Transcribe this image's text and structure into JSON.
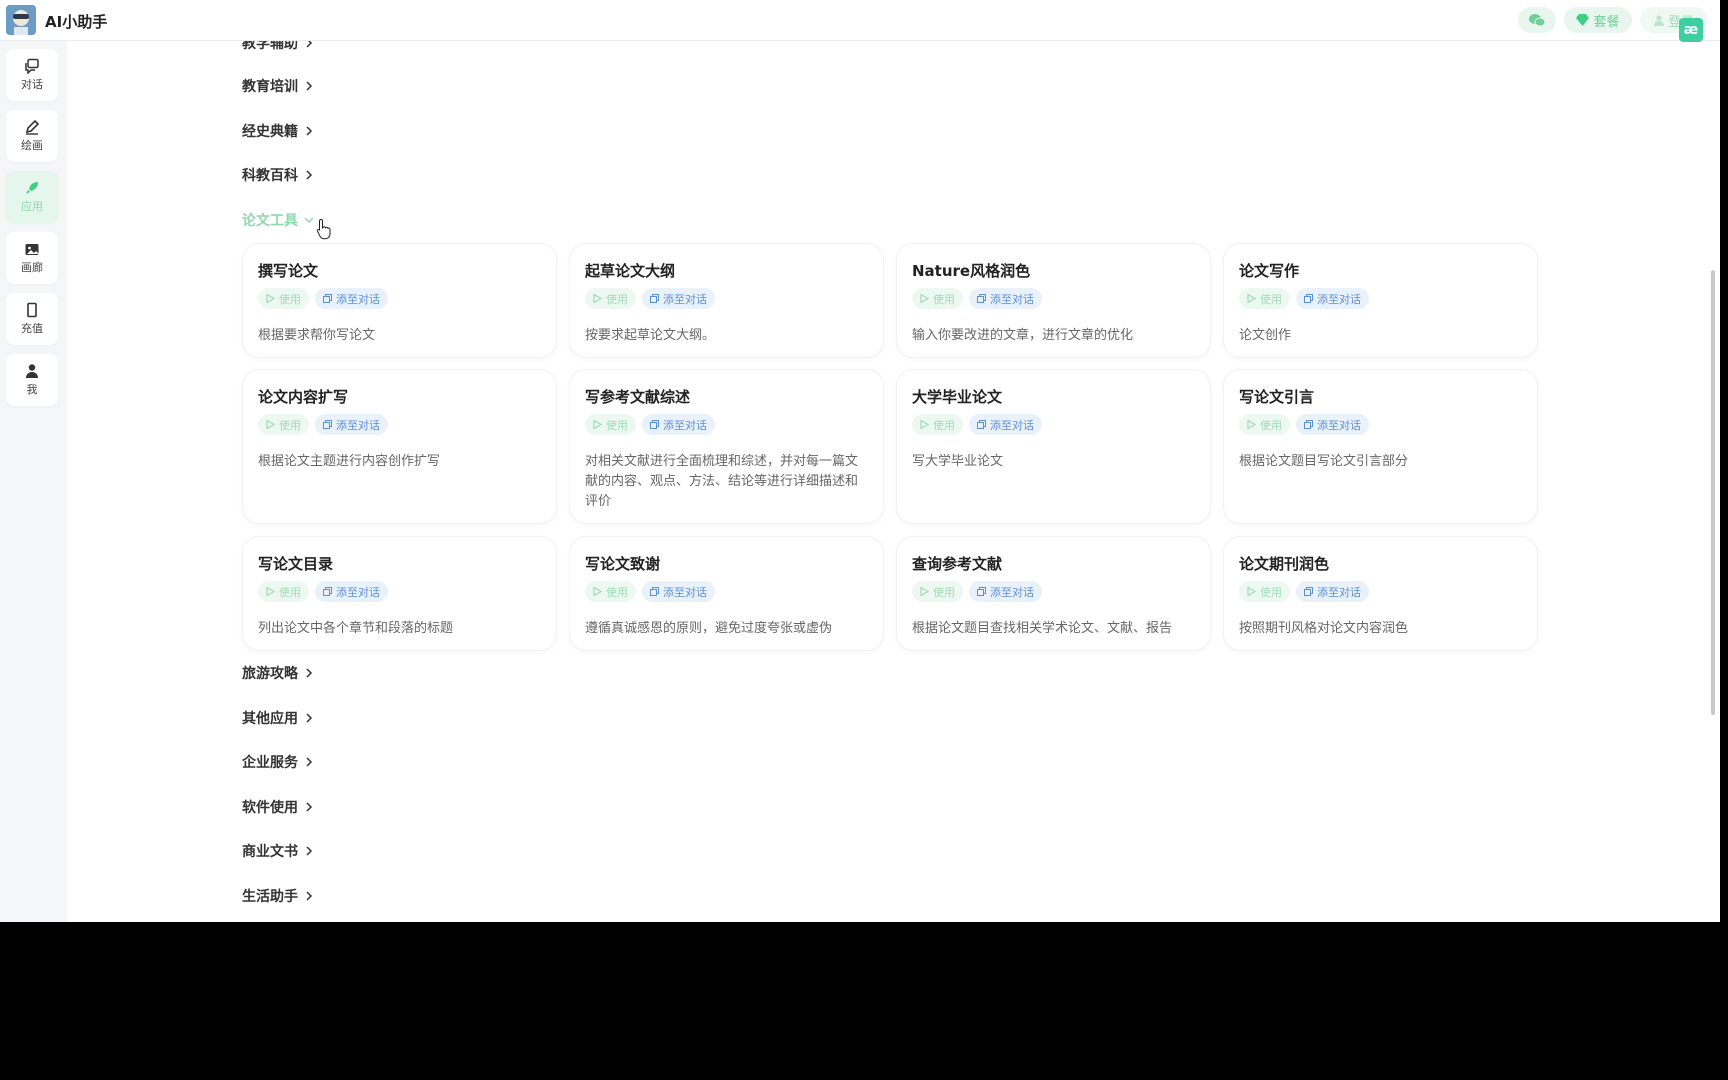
{
  "header": {
    "title": "AI小助手",
    "wechat_icon": "wechat-icon",
    "package_label": "套餐",
    "login_label": "登录",
    "badge_text": "æ"
  },
  "sidebar": {
    "items": [
      {
        "label": "对话",
        "icon": "chat-icon"
      },
      {
        "label": "绘画",
        "icon": "pen-icon"
      },
      {
        "label": "应用",
        "icon": "rocket-icon",
        "active": true
      },
      {
        "label": "画廊",
        "icon": "gallery-icon"
      },
      {
        "label": "充值",
        "icon": "phone-icon"
      },
      {
        "label": "我",
        "icon": "user-icon"
      }
    ]
  },
  "categories_top": [
    {
      "label": "教学辅助"
    },
    {
      "label": "教育培训"
    },
    {
      "label": "经史典籍"
    },
    {
      "label": "科教百科"
    },
    {
      "label": "论文工具",
      "expanded": true
    }
  ],
  "cards": [
    {
      "title": "撰写论文",
      "use": "使用",
      "add": "添至对话",
      "desc": "根据要求帮你写论文"
    },
    {
      "title": "起草论文大纲",
      "use": "使用",
      "add": "添至对话",
      "desc": "按要求起草论文大纲。"
    },
    {
      "title": "Nature风格润色",
      "use": "使用",
      "add": "添至对话",
      "desc": "输入你要改进的文章，进行文章的优化"
    },
    {
      "title": "论文写作",
      "use": "使用",
      "add": "添至对话",
      "desc": "论文创作"
    },
    {
      "title": "论文内容扩写",
      "use": "使用",
      "add": "添至对话",
      "desc": "根据论文主题进行内容创作扩写"
    },
    {
      "title": "写参考文献综述",
      "use": "使用",
      "add": "添至对话",
      "desc": "对相关文献进行全面梳理和综述，并对每一篇文献的内容、观点、方法、结论等进行详细描述和评价"
    },
    {
      "title": "大学毕业论文",
      "use": "使用",
      "add": "添至对话",
      "desc": "写大学毕业论文"
    },
    {
      "title": "写论文引言",
      "use": "使用",
      "add": "添至对话",
      "desc": "根据论文题目写论文引言部分"
    },
    {
      "title": "写论文目录",
      "use": "使用",
      "add": "添至对话",
      "desc": "列出论文中各个章节和段落的标题"
    },
    {
      "title": "写论文致谢",
      "use": "使用",
      "add": "添至对话",
      "desc": "遵循真诚感恩的原则，避免过度夸张或虚伪"
    },
    {
      "title": "查询参考文献",
      "use": "使用",
      "add": "添至对话",
      "desc": "根据论文题目查找相关学术论文、文献、报告"
    },
    {
      "title": "论文期刊润色",
      "use": "使用",
      "add": "添至对话",
      "desc": "按照期刊风格对论文内容润色"
    }
  ],
  "categories_bottom": [
    {
      "label": "旅游攻略"
    },
    {
      "label": "其他应用"
    },
    {
      "label": "企业服务"
    },
    {
      "label": "软件使用"
    },
    {
      "label": "商业文书"
    },
    {
      "label": "生活助手"
    }
  ],
  "colors": {
    "accent_green": "#8fd9ac",
    "add_blue": "#5b8fd6",
    "sidebar_bg": "#f5f6f7"
  }
}
